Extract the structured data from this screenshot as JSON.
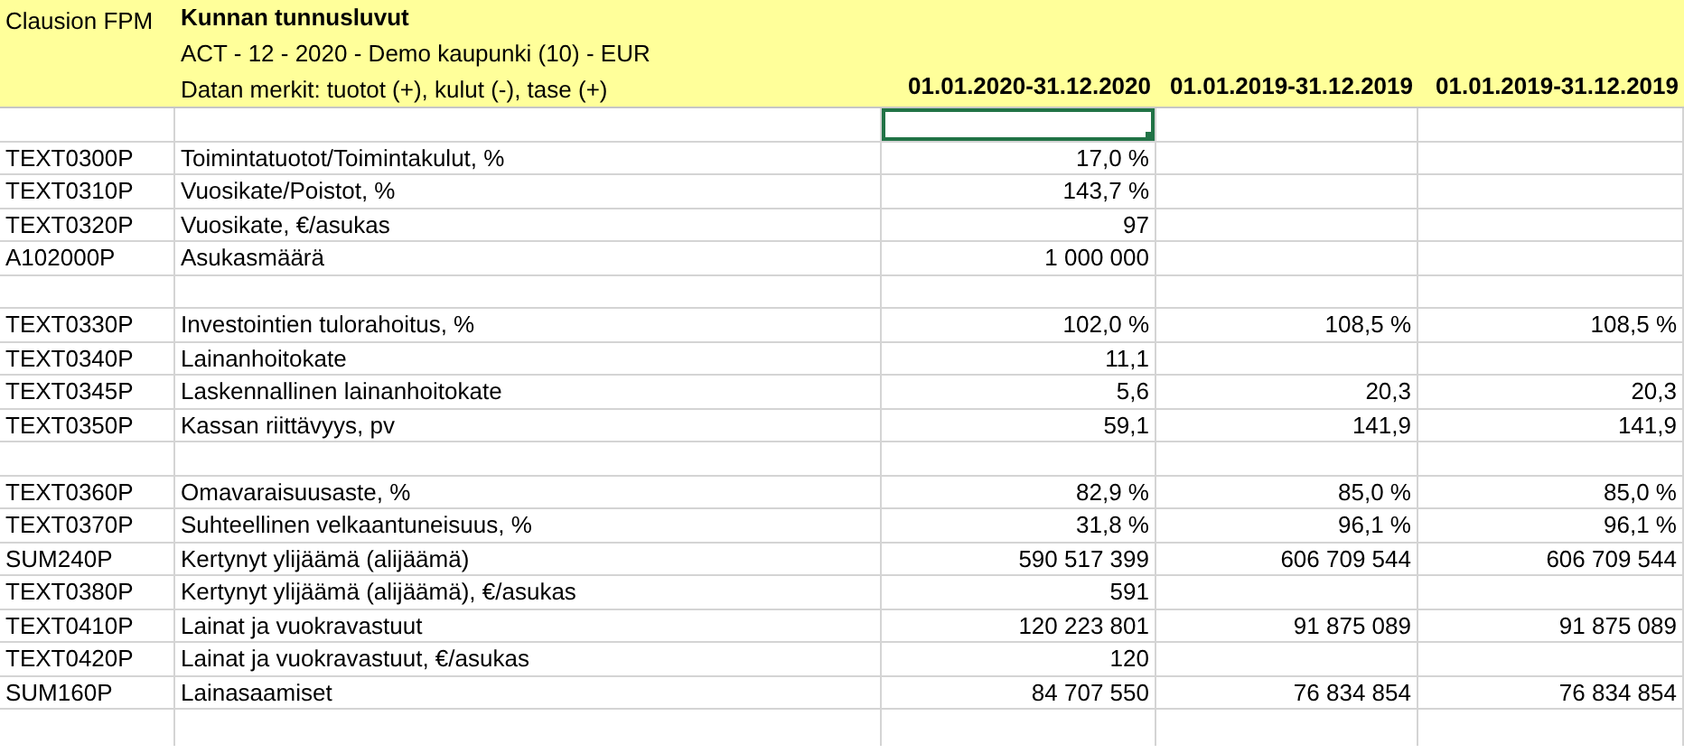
{
  "header": {
    "left_label": "Clausion FPM",
    "title": "Kunnan tunnusluvut",
    "subtitle": "ACT - 12 - 2020 - Demo kaupunki (10) - EUR",
    "note": "Datan merkit: tuotot (+), kulut (-), tase (+)",
    "periods": [
      "01.01.2020-31.12.2020",
      "01.01.2019-31.12.2019",
      "01.01.2019-31.12.2019"
    ]
  },
  "rows": [
    {
      "kind": "blank",
      "selected": true
    },
    {
      "kind": "data",
      "code": "TEXT0300P",
      "label": "Toimintatuotot/Toimintakulut, %",
      "values": [
        "17,0 %"
      ]
    },
    {
      "kind": "data",
      "code": "TEXT0310P",
      "label": "Vuosikate/Poistot, %",
      "values": [
        "143,7 %"
      ]
    },
    {
      "kind": "data",
      "code": "TEXT0320P",
      "label": "Vuosikate, €/asukas",
      "values": [
        "97"
      ]
    },
    {
      "kind": "data",
      "code": "A102000P",
      "label": "Asukasmäärä",
      "values": [
        "1 000 000"
      ]
    },
    {
      "kind": "blank",
      "selected": false
    },
    {
      "kind": "data",
      "code": "TEXT0330P",
      "label": "Investointien tulorahoitus, %",
      "values": [
        "102,0 %",
        "108,5 %",
        "108,5 %"
      ]
    },
    {
      "kind": "data",
      "code": "TEXT0340P",
      "label": "Lainanhoitokate",
      "values": [
        "11,1"
      ]
    },
    {
      "kind": "data",
      "code": "TEXT0345P",
      "label": "Laskennallinen lainanhoitokate",
      "values": [
        "5,6",
        "20,3",
        "20,3"
      ]
    },
    {
      "kind": "data",
      "code": "TEXT0350P",
      "label": "Kassan riittävyys, pv",
      "values": [
        "59,1",
        "141,9",
        "141,9"
      ]
    },
    {
      "kind": "blank",
      "selected": false
    },
    {
      "kind": "data",
      "code": "TEXT0360P",
      "label": "Omavaraisuusaste, %",
      "values": [
        "82,9 %",
        "85,0 %",
        "85,0 %"
      ]
    },
    {
      "kind": "data",
      "code": "TEXT0370P",
      "label": "Suhteellinen velkaantuneisuus, %",
      "values": [
        "31,8 %",
        "96,1 %",
        "96,1 %"
      ]
    },
    {
      "kind": "data",
      "code": "SUM240P",
      "label": "Kertynyt ylijäämä (alijäämä)",
      "values": [
        "590 517 399",
        "606 709 544",
        "606 709 544"
      ]
    },
    {
      "kind": "data",
      "code": "TEXT0380P",
      "label": "Kertynyt ylijäämä (alijäämä), €/asukas",
      "values": [
        "591"
      ]
    },
    {
      "kind": "data",
      "code": "TEXT0410P",
      "label": "Lainat ja vuokravastuut",
      "values": [
        "120 223 801",
        "91 875 089",
        "91 875 089"
      ]
    },
    {
      "kind": "data",
      "code": "TEXT0420P",
      "label": "Lainat ja vuokravastuut, €/asukas",
      "values": [
        "120"
      ]
    },
    {
      "kind": "data",
      "code": "SUM160P",
      "label": "Lainasaamiset",
      "values": [
        "84 707 550",
        "76 834 854",
        "76 834 854"
      ]
    }
  ]
}
